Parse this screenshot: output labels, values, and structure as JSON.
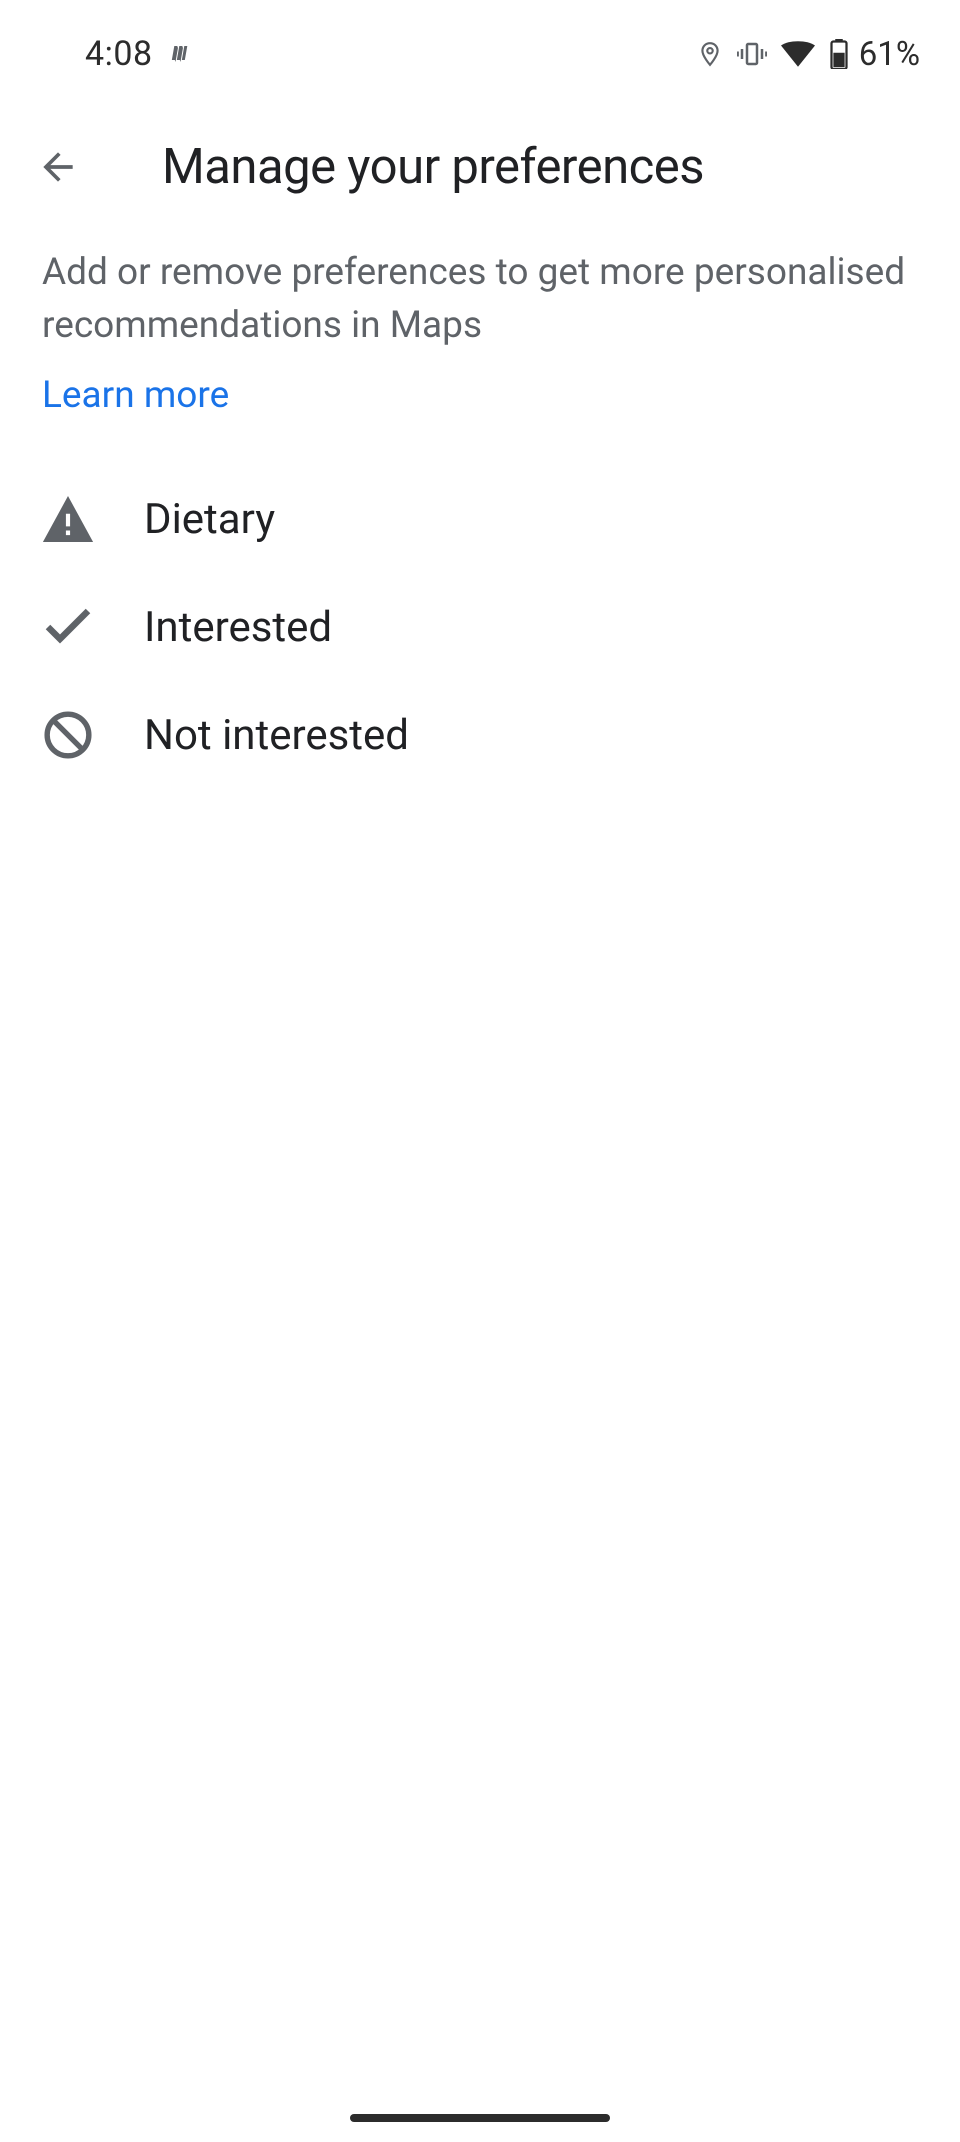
{
  "status_bar": {
    "time": "4:08",
    "battery": "61%"
  },
  "header": {
    "title": "Manage your preferences"
  },
  "description": "Add or remove preferences to get more personalised recommendations in Maps",
  "learn_more": "Learn more",
  "preferences": [
    {
      "label": "Dietary"
    },
    {
      "label": "Interested"
    },
    {
      "label": "Not interested"
    }
  ]
}
